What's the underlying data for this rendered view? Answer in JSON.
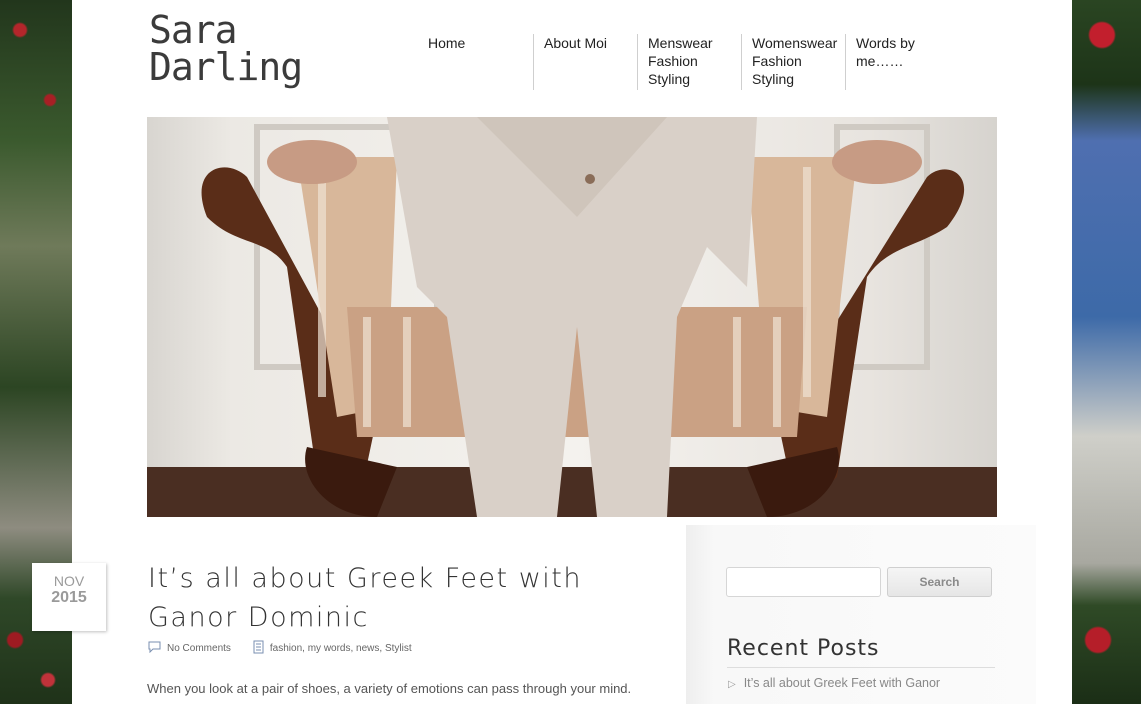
{
  "site": {
    "logo_line1": "Sara",
    "logo_line2": "Darling"
  },
  "nav": [
    {
      "label": "Home"
    },
    {
      "label": "About Moi"
    },
    {
      "label": "Menswear Fashion Styling"
    },
    {
      "label": "Womenswear Fashion Styling"
    },
    {
      "label": "Words by me……"
    }
  ],
  "post": {
    "date_month": "NOV",
    "date_year": "2015",
    "title": "It’s all about Greek Feet with Ganor Dominic",
    "comments": "No Comments",
    "categories": "fashion, my words, news, Stylist",
    "excerpt": "When you look at a pair of shoes, a variety of emotions can pass through your mind."
  },
  "sidebar": {
    "search_button": "Search",
    "search_placeholder": "",
    "recent_posts_title": "Recent Posts",
    "recent_posts": [
      "It’s all about Greek Feet with Ganor"
    ]
  },
  "icons": {
    "comment": "comment-icon",
    "category": "category-icon",
    "arrow": "arrow-right-icon"
  }
}
